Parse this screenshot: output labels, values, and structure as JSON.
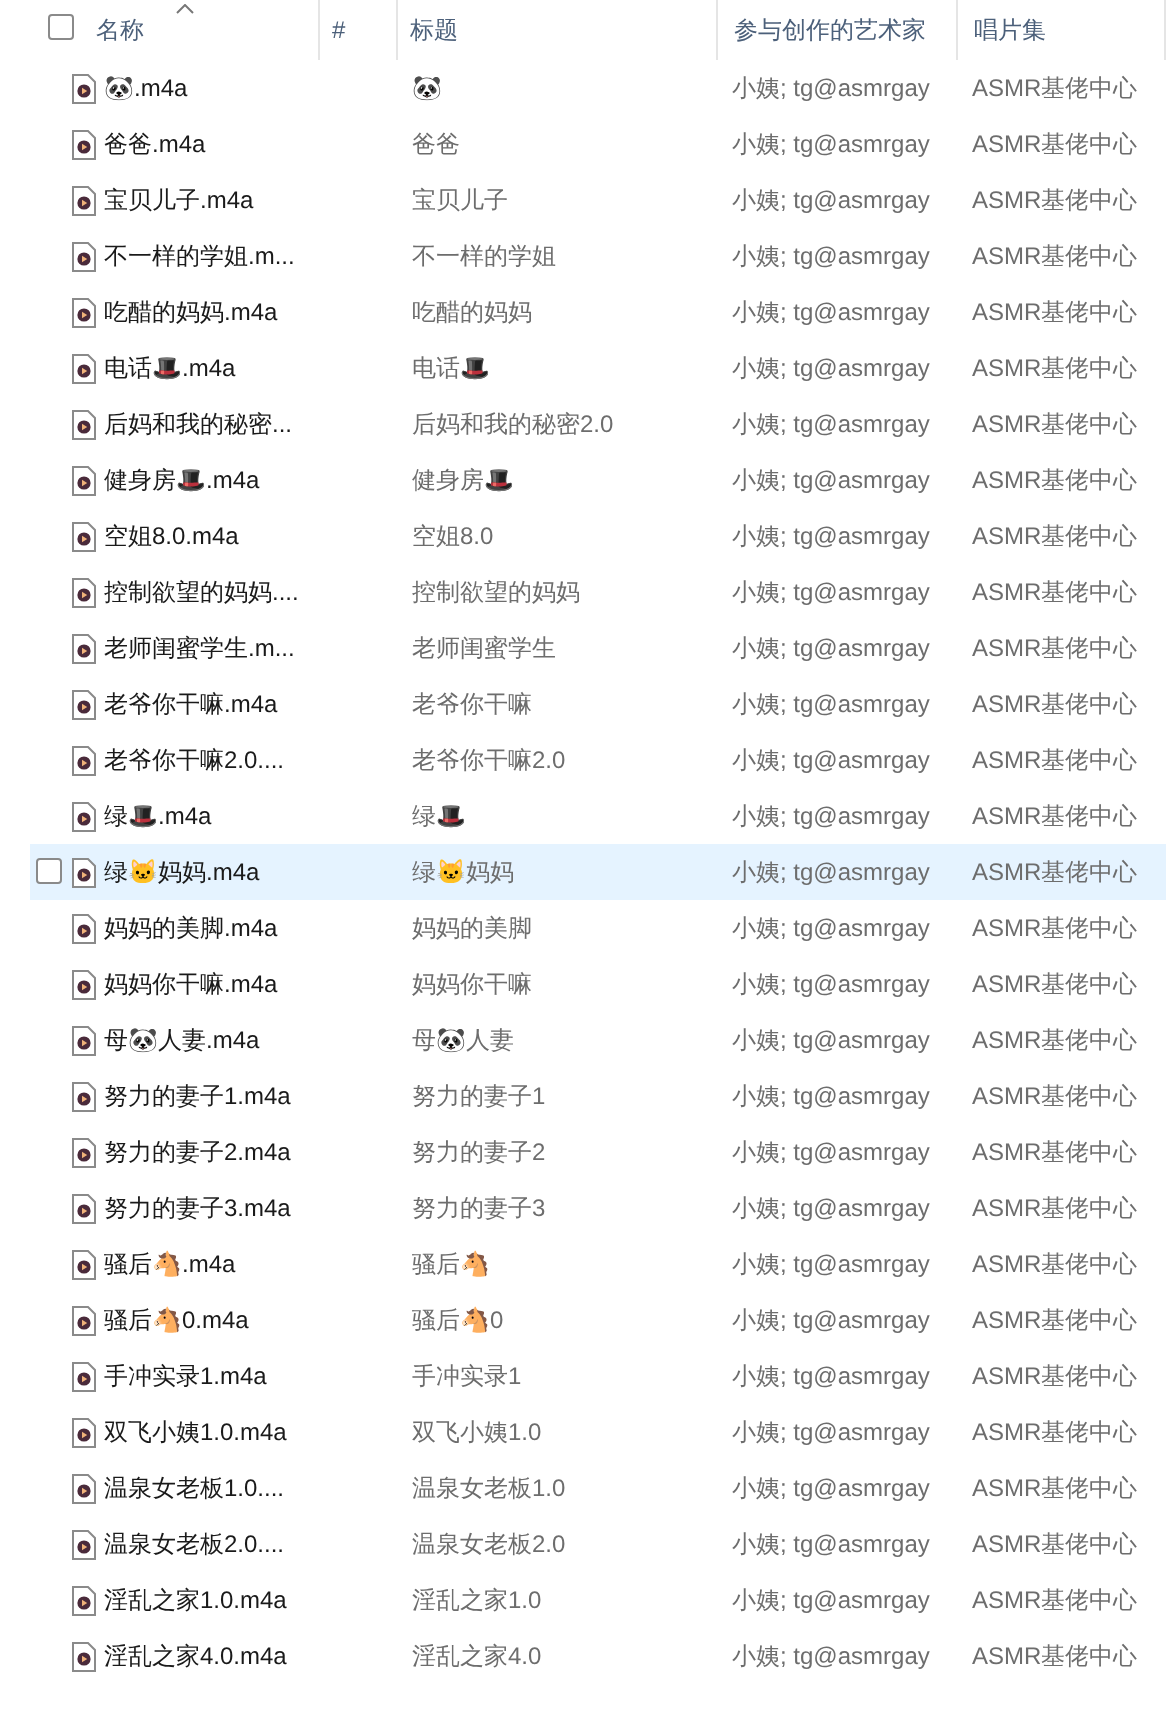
{
  "select_all": {
    "checked": false
  },
  "columns": [
    {
      "label": "名称",
      "sorted": true
    },
    {
      "label": "#",
      "sorted": false
    },
    {
      "label": "标题",
      "sorted": false
    },
    {
      "label": "参与创作的艺术家",
      "sorted": false
    },
    {
      "label": "唱片集",
      "sorted": false
    }
  ],
  "rows": [
    {
      "name": "🐼.m4a",
      "title": "🐼",
      "artist": "小姨; tg@asmrgay",
      "album": "ASMR基佬中心",
      "selected": false
    },
    {
      "name": "爸爸.m4a",
      "title": "爸爸",
      "artist": "小姨; tg@asmrgay",
      "album": "ASMR基佬中心",
      "selected": false
    },
    {
      "name": "宝贝儿子.m4a",
      "title": "宝贝儿子",
      "artist": "小姨; tg@asmrgay",
      "album": "ASMR基佬中心",
      "selected": false
    },
    {
      "name": "不一样的学姐.m...",
      "title": "不一样的学姐",
      "artist": "小姨; tg@asmrgay",
      "album": "ASMR基佬中心",
      "selected": false
    },
    {
      "name": "吃醋的妈妈.m4a",
      "title": "吃醋的妈妈",
      "artist": "小姨; tg@asmrgay",
      "album": "ASMR基佬中心",
      "selected": false
    },
    {
      "name": "电话🎩.m4a",
      "title": "电话🎩",
      "artist": "小姨; tg@asmrgay",
      "album": "ASMR基佬中心",
      "selected": false
    },
    {
      "name": "后妈和我的秘密...",
      "title": "后妈和我的秘密2.0",
      "artist": "小姨; tg@asmrgay",
      "album": "ASMR基佬中心",
      "selected": false
    },
    {
      "name": "健身房🎩.m4a",
      "title": "健身房🎩",
      "artist": "小姨; tg@asmrgay",
      "album": "ASMR基佬中心",
      "selected": false
    },
    {
      "name": "空姐8.0.m4a",
      "title": "空姐8.0",
      "artist": "小姨; tg@asmrgay",
      "album": "ASMR基佬中心",
      "selected": false
    },
    {
      "name": "控制欲望的妈妈....",
      "title": "控制欲望的妈妈",
      "artist": "小姨; tg@asmrgay",
      "album": "ASMR基佬中心",
      "selected": false
    },
    {
      "name": "老师闺蜜学生.m...",
      "title": "老师闺蜜学生",
      "artist": "小姨; tg@asmrgay",
      "album": "ASMR基佬中心",
      "selected": false
    },
    {
      "name": "老爷你干嘛.m4a",
      "title": "老爷你干嘛",
      "artist": "小姨; tg@asmrgay",
      "album": "ASMR基佬中心",
      "selected": false
    },
    {
      "name": "老爷你干嘛2.0....",
      "title": "老爷你干嘛2.0",
      "artist": "小姨; tg@asmrgay",
      "album": "ASMR基佬中心",
      "selected": false
    },
    {
      "name": "绿🎩.m4a",
      "title": "绿🎩",
      "artist": "小姨; tg@asmrgay",
      "album": "ASMR基佬中心",
      "selected": false
    },
    {
      "name": "绿🐱妈妈.m4a",
      "title": "绿🐱妈妈",
      "artist": "小姨; tg@asmrgay",
      "album": "ASMR基佬中心",
      "selected": true
    },
    {
      "name": "妈妈的美脚.m4a",
      "title": "妈妈的美脚",
      "artist": "小姨; tg@asmrgay",
      "album": "ASMR基佬中心",
      "selected": false
    },
    {
      "name": "妈妈你干嘛.m4a",
      "title": "妈妈你干嘛",
      "artist": "小姨; tg@asmrgay",
      "album": "ASMR基佬中心",
      "selected": false
    },
    {
      "name": "母🐼人妻.m4a",
      "title": "母🐼人妻",
      "artist": "小姨; tg@asmrgay",
      "album": "ASMR基佬中心",
      "selected": false
    },
    {
      "name": "努力的妻子1.m4a",
      "title": "努力的妻子1",
      "artist": "小姨; tg@asmrgay",
      "album": "ASMR基佬中心",
      "selected": false
    },
    {
      "name": "努力的妻子2.m4a",
      "title": "努力的妻子2",
      "artist": "小姨; tg@asmrgay",
      "album": "ASMR基佬中心",
      "selected": false
    },
    {
      "name": "努力的妻子3.m4a",
      "title": "努力的妻子3",
      "artist": "小姨; tg@asmrgay",
      "album": "ASMR基佬中心",
      "selected": false
    },
    {
      "name": "骚后🐴.m4a",
      "title": "骚后🐴",
      "artist": "小姨; tg@asmrgay",
      "album": "ASMR基佬中心",
      "selected": false
    },
    {
      "name": "骚后🐴0.m4a",
      "title": "骚后🐴0",
      "artist": "小姨; tg@asmrgay",
      "album": "ASMR基佬中心",
      "selected": false
    },
    {
      "name": "手冲实录1.m4a",
      "title": "手冲实录1",
      "artist": "小姨; tg@asmrgay",
      "album": "ASMR基佬中心",
      "selected": false
    },
    {
      "name": "双飞小姨1.0.m4a",
      "title": "双飞小姨1.0",
      "artist": "小姨; tg@asmrgay",
      "album": "ASMR基佬中心",
      "selected": false
    },
    {
      "name": "温泉女老板1.0....",
      "title": "温泉女老板1.0",
      "artist": "小姨; tg@asmrgay",
      "album": "ASMR基佬中心",
      "selected": false
    },
    {
      "name": "温泉女老板2.0....",
      "title": "温泉女老板2.0",
      "artist": "小姨; tg@asmrgay",
      "album": "ASMR基佬中心",
      "selected": false
    },
    {
      "name": "淫乱之家1.0.m4a",
      "title": "淫乱之家1.0",
      "artist": "小姨; tg@asmrgay",
      "album": "ASMR基佬中心",
      "selected": false
    },
    {
      "name": "淫乱之家4.0.m4a",
      "title": "淫乱之家4.0",
      "artist": "小姨; tg@asmrgay",
      "album": "ASMR基佬中心",
      "selected": false
    }
  ]
}
